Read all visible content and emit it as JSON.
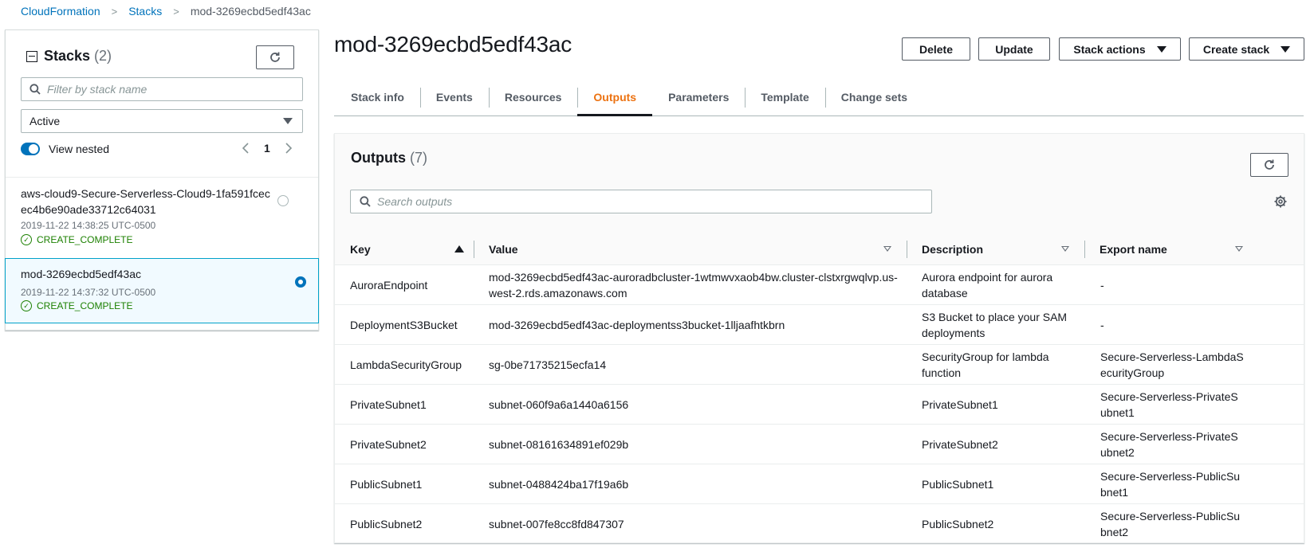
{
  "breadcrumb": {
    "root": "CloudFormation",
    "section": "Stacks",
    "current": "mod-3269ecbd5edf43ac"
  },
  "sidebar": {
    "title": "Stacks",
    "count": "(2)",
    "filter_placeholder": "Filter by stack name",
    "status_filter": "Active",
    "view_nested_label": "View nested",
    "page": "1",
    "stacks": [
      {
        "name": "aws-cloud9-Secure-Serverless-Cloud9-1fa591fcec ec4b6e90ade33712c64031",
        "time": "2019-11-22 14:38:25 UTC-0500",
        "status": "CREATE_COMPLETE"
      },
      {
        "name": "mod-3269ecbd5edf43ac",
        "time": "2019-11-22 14:37:32 UTC-0500",
        "status": "CREATE_COMPLETE"
      }
    ]
  },
  "main": {
    "title": "mod-3269ecbd5edf43ac",
    "buttons": {
      "delete": "Delete",
      "update": "Update",
      "stack_actions": "Stack actions",
      "create_stack": "Create stack"
    },
    "tabs": [
      "Stack info",
      "Events",
      "Resources",
      "Outputs",
      "Parameters",
      "Template",
      "Change sets"
    ],
    "active_tab": "Outputs"
  },
  "outputs": {
    "title": "Outputs",
    "count": "(7)",
    "search_placeholder": "Search outputs",
    "columns": [
      "Key",
      "Value",
      "Description",
      "Export name"
    ],
    "rows": [
      {
        "key": "AuroraEndpoint",
        "value": "mod-3269ecbd5edf43ac-auroradbcluster-1wtmwvxaob4bw.cluster-clstxrgwqlvp.us-west-2.rds.amazonaws.com",
        "description": "Aurora endpoint for aurora database",
        "export": "-"
      },
      {
        "key": "DeploymentS3Bucket",
        "value": "mod-3269ecbd5edf43ac-deploymentss3bucket-1lljaafhtkbrn",
        "description": "S3 Bucket to place your SAM deployments",
        "export": "-"
      },
      {
        "key": "LambdaSecurityGroup",
        "value": "sg-0be71735215ecfa14",
        "description": "SecurityGroup for lambda function",
        "export": "Secure-Serverless-LambdaSecurityGroup"
      },
      {
        "key": "PrivateSubnet1",
        "value": "subnet-060f9a6a1440a6156",
        "description": "PrivateSubnet1",
        "export": "Secure-Serverless-PrivateSubnet1"
      },
      {
        "key": "PrivateSubnet2",
        "value": "subnet-08161634891ef029b",
        "description": "PrivateSubnet2",
        "export": "Secure-Serverless-PrivateSubnet2"
      },
      {
        "key": "PublicSubnet1",
        "value": "subnet-0488424ba17f19a6b",
        "description": "PublicSubnet1",
        "export": "Secure-Serverless-PublicSubnet1"
      },
      {
        "key": "PublicSubnet2",
        "value": "subnet-007fe8cc8fd847307",
        "description": "PublicSubnet2",
        "export": "Secure-Serverless-PublicSubnet2"
      }
    ]
  },
  "colors": {
    "link": "#0073bb",
    "active_tab": "#ec7211",
    "success": "#1d8102",
    "selected_bg": "#f1faff"
  }
}
